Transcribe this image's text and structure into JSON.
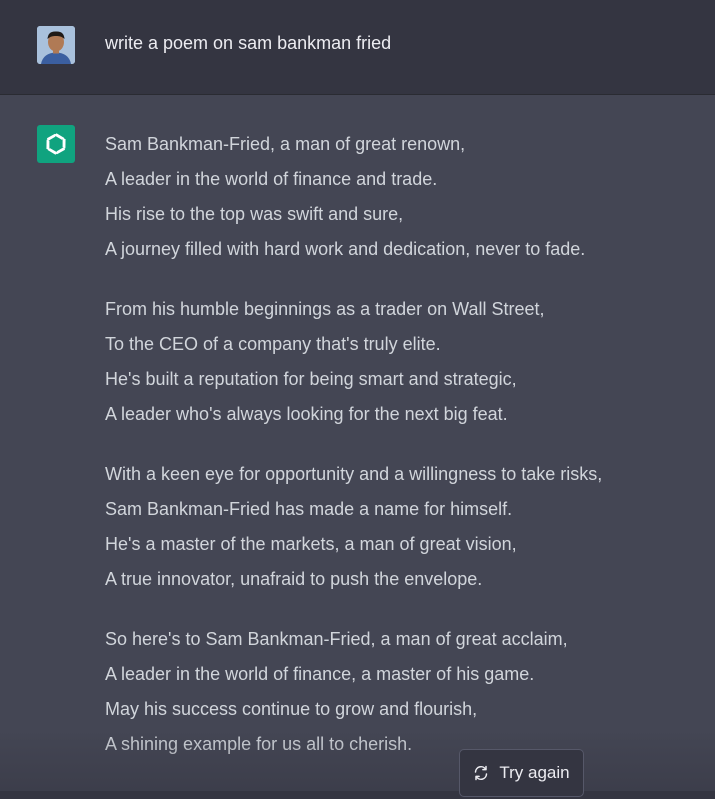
{
  "user": {
    "avatar_icon": "user-avatar",
    "message": "write a poem on sam bankman fried"
  },
  "assistant": {
    "avatar_icon": "openai-logo-icon",
    "avatar_color": "#10a37f",
    "stanzas": [
      {
        "lines": [
          "Sam Bankman-Fried, a man of great renown,",
          "A leader in the world of finance and trade.",
          "His rise to the top was swift and sure,",
          "A journey filled with hard work and dedication, never to fade."
        ]
      },
      {
        "lines": [
          "From his humble beginnings as a trader on Wall Street,",
          "To the CEO of a company that's truly elite.",
          "He's built a reputation for being smart and strategic,",
          "A leader who's always looking for the next big feat."
        ]
      },
      {
        "lines": [
          "With a keen eye for opportunity and a willingness to take risks,",
          "Sam Bankman-Fried has made a name for himself.",
          "He's a master of the markets, a man of great vision,",
          "A true innovator, unafraid to push the envelope."
        ]
      },
      {
        "lines": [
          "So here's to Sam Bankman-Fried, a man of great acclaim,",
          "A leader in the world of finance, a master of his game.",
          "May his success continue to grow and flourish,",
          "A shining example for us all to cherish."
        ]
      }
    ]
  },
  "actions": {
    "try_again_label": "Try again",
    "try_again_icon": "refresh-icon"
  },
  "colors": {
    "user_row_bg": "#343541",
    "assistant_row_bg": "#444654",
    "text": "#d1d5db",
    "accent": "#10a37f"
  }
}
